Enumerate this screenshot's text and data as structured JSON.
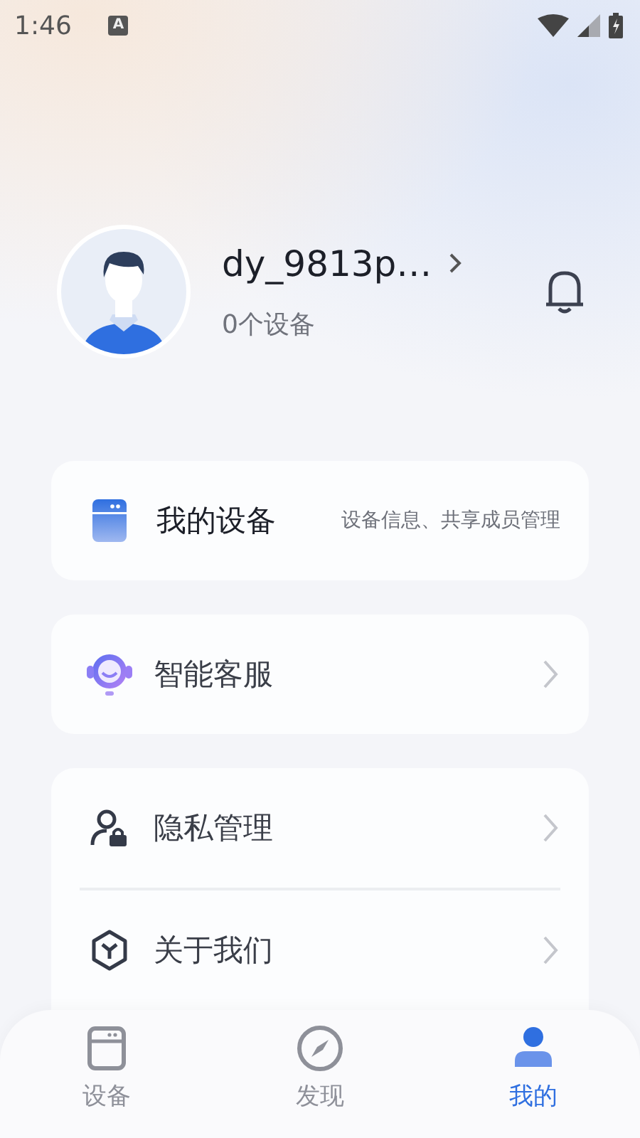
{
  "status_bar": {
    "time": "1:46",
    "notification": "A"
  },
  "profile": {
    "name": "dy_9813p…",
    "device_count": "0个设备"
  },
  "cards": [
    {
      "rows": [
        {
          "kind": "device",
          "title": "我的设备",
          "subtitle": "设备信息、共享成员管理"
        }
      ]
    },
    {
      "rows": [
        {
          "kind": "link",
          "title": "智能客服"
        }
      ]
    },
    {
      "rows": [
        {
          "kind": "link",
          "title": "隐私管理"
        },
        {
          "kind": "link",
          "title": "关于我们"
        }
      ]
    }
  ],
  "nav": [
    {
      "label": "设备",
      "selected": false
    },
    {
      "label": "发现",
      "selected": false
    },
    {
      "label": "我的",
      "selected": true
    }
  ]
}
